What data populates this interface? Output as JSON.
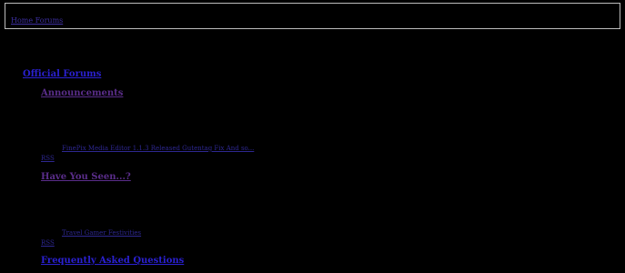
{
  "breadcrumb": {
    "home_label": "Home Forums"
  },
  "category": {
    "title": "Official Forums"
  },
  "forums": [
    {
      "title": "Announcements",
      "last_post": "FinePix Media Editor 1.1.3 Released Gutentag Fix And so...",
      "rss": "RSS"
    },
    {
      "title": "Have You Seen...?",
      "last_post": "Travel Gamer Festivities",
      "rss": "RSS"
    },
    {
      "title": "Frequently Asked Questions"
    }
  ]
}
